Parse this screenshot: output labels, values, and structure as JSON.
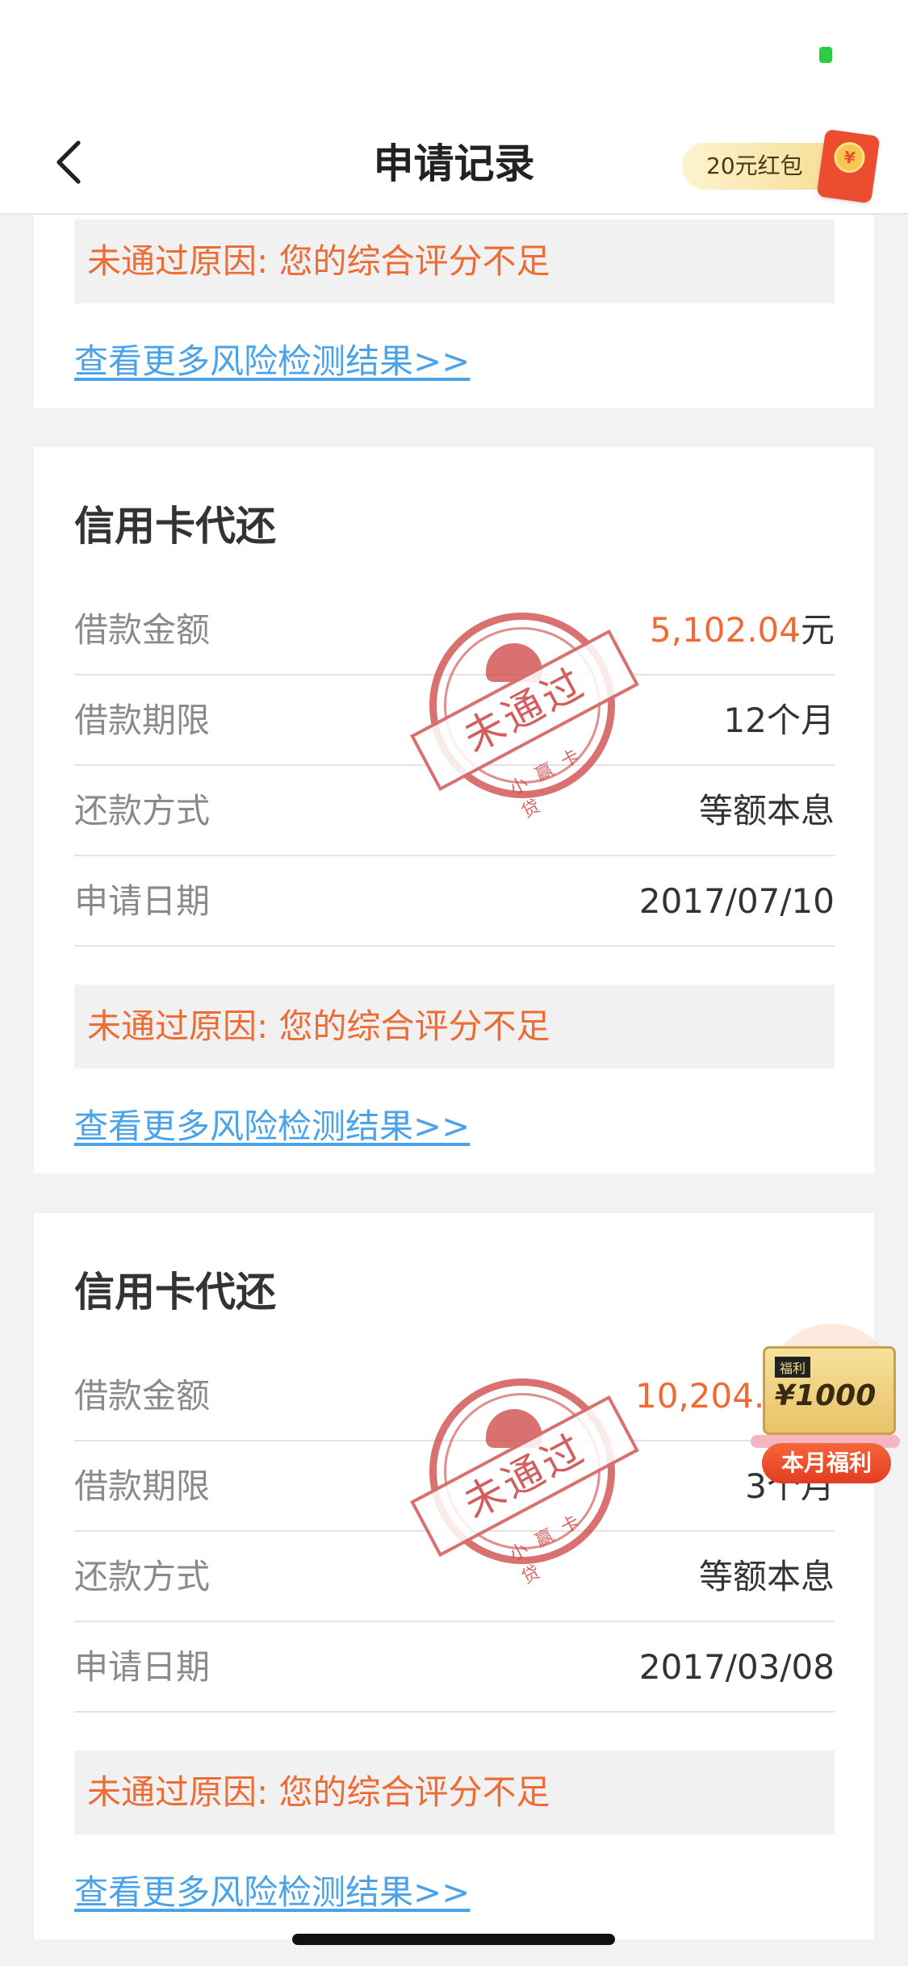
{
  "nav": {
    "title": "申请记录",
    "back_icon": "chevron-left-icon",
    "redpacket_label": "20元红包",
    "redpacket_coin": "¥"
  },
  "card0": {
    "reason": "未通过原因: 您的综合评分不足",
    "link": "查看更多风险检测结果>>"
  },
  "applications": [
    {
      "title": "信用卡代还",
      "amount_label": "借款金额",
      "amount": "5,102.04",
      "amount_unit": "元",
      "term_label": "借款期限",
      "term": "12个月",
      "repay_label": "还款方式",
      "repay": "等额本息",
      "date_label": "申请日期",
      "date": "2017/07/10",
      "reason": "未通过原因: 您的综合评分不足",
      "link": "查看更多风险检测结果>>",
      "stamp_text": "未通过",
      "stamp_sub": "小赢卡贷"
    },
    {
      "title": "信用卡代还",
      "amount_label": "借款金额",
      "amount": "10,204.0",
      "term_label": "借款期限",
      "term": "3个月",
      "repay_label": "还款方式",
      "repay": "等额本息",
      "date_label": "申请日期",
      "date": "2017/03/08",
      "reason": "未通过原因: 您的综合评分不足",
      "link": "查看更多风险检测结果>>",
      "stamp_text": "未通过",
      "stamp_sub": "小赢卡贷"
    }
  ],
  "promo": {
    "tag": "福利",
    "amount": "¥1000",
    "label": "本月福利"
  },
  "colors": {
    "accent_orange": "#ef6b34",
    "link_blue": "#4aa3e8",
    "stamp_red": "#cc4242"
  }
}
